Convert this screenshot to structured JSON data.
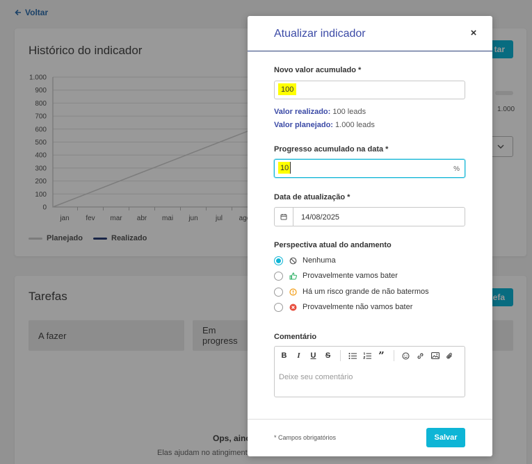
{
  "back_link": {
    "label": "Voltar"
  },
  "history_card": {
    "title": "Histórico do indicador",
    "action_button_label": "tar",
    "y_ticks": [
      "1.000",
      "900",
      "800",
      "700",
      "600",
      "500",
      "400",
      "300",
      "200",
      "100",
      "0"
    ],
    "x_ticks": [
      "jan",
      "fev",
      "mar",
      "abr",
      "mai",
      "jun",
      "jul",
      "ago"
    ],
    "legend": [
      {
        "label": "Planejado",
        "color": "#cfcfcf"
      },
      {
        "label": "Realizado",
        "color": "#2b3f77"
      }
    ],
    "progress_max_label": "1.000"
  },
  "chart_data": {
    "type": "line",
    "categories": [
      "jan",
      "fev",
      "mar",
      "abr",
      "mai",
      "jun",
      "jul",
      "ago"
    ],
    "ylim": [
      0,
      1000
    ],
    "series": [
      {
        "name": "Planejado",
        "values": [
          0,
          83,
          167,
          250,
          333,
          417,
          500,
          583
        ]
      }
    ]
  },
  "tasks_card": {
    "title": "Tarefas",
    "action_button_label": "efa",
    "columns": [
      "A fazer",
      "Em progress"
    ],
    "empty_title": "Ops, ainc",
    "empty_subtitle": "Elas ajudam no atingiment"
  },
  "modal": {
    "title": "Atualizar indicador",
    "close_label": "×",
    "accumulated_label": "Novo valor acumulado *",
    "accumulated_value": "100",
    "realized_label": "Valor realizado:",
    "realized_value": "100 leads",
    "planned_label": "Valor planejado:",
    "planned_value": "1.000 leads",
    "progress_label": "Progresso acumulado na data *",
    "progress_value": "10",
    "progress_suffix": "%",
    "date_label": "Data de atualização *",
    "date_value": "14/08/2025",
    "perspective_label": "Perspectiva atual do andamento",
    "perspective_options": [
      {
        "label": "Nenhuma",
        "icon": "ban-icon",
        "selected": true
      },
      {
        "label": "Provavelmente vamos bater",
        "icon": "thumbs-up-icon",
        "selected": false
      },
      {
        "label": "Há um risco grande de não batermos",
        "icon": "warning-icon",
        "selected": false
      },
      {
        "label": "Provavelmente não vamos bater",
        "icon": "error-icon",
        "selected": false
      }
    ],
    "comment_label": "Comentário",
    "comment_placeholder": "Deixe seu comentário",
    "required_note": "* Campos obrigatórios",
    "save_label": "Salvar"
  },
  "colors": {
    "accent": "#0eb5d6",
    "title_blue": "#3b4aa6",
    "highlight": "#ffff00"
  }
}
